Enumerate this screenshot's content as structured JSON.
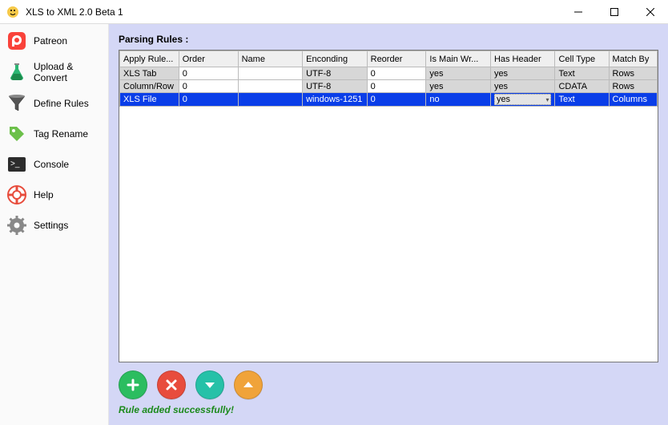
{
  "window": {
    "title": "XLS to XML 2.0 Beta 1"
  },
  "sidebar": {
    "items": [
      {
        "label": "Patreon"
      },
      {
        "label": "Upload & Convert"
      },
      {
        "label": "Define Rules"
      },
      {
        "label": "Tag Rename"
      },
      {
        "label": "Console"
      },
      {
        "label": "Help"
      },
      {
        "label": "Settings"
      }
    ]
  },
  "main": {
    "section_title": "Parsing Rules :",
    "columns": [
      "Apply Rule...",
      "Order",
      "Name",
      "Enconding",
      "Reorder",
      "Is Main Wr...",
      "Has Header",
      "Cell Type",
      "Match By"
    ],
    "rows": [
      {
        "apply": "XLS Tab",
        "order": "0",
        "name": "",
        "encoding": "UTF-8",
        "reorder": "0",
        "is_main": "yes",
        "has_header": "yes",
        "cell_type": "Text",
        "match_by": "Rows",
        "selected": false
      },
      {
        "apply": "Column/Row",
        "order": "0",
        "name": "",
        "encoding": "UTF-8",
        "reorder": "0",
        "is_main": "yes",
        "has_header": "yes",
        "cell_type": "CDATA",
        "match_by": "Rows",
        "selected": false
      },
      {
        "apply": "XLS File",
        "order": "0",
        "name": "",
        "encoding": "windows-1251",
        "reorder": "0",
        "is_main": "no",
        "has_header": "yes",
        "cell_type": "Text",
        "match_by": "Columns",
        "selected": true
      }
    ],
    "status": "Rule added successfully!"
  }
}
